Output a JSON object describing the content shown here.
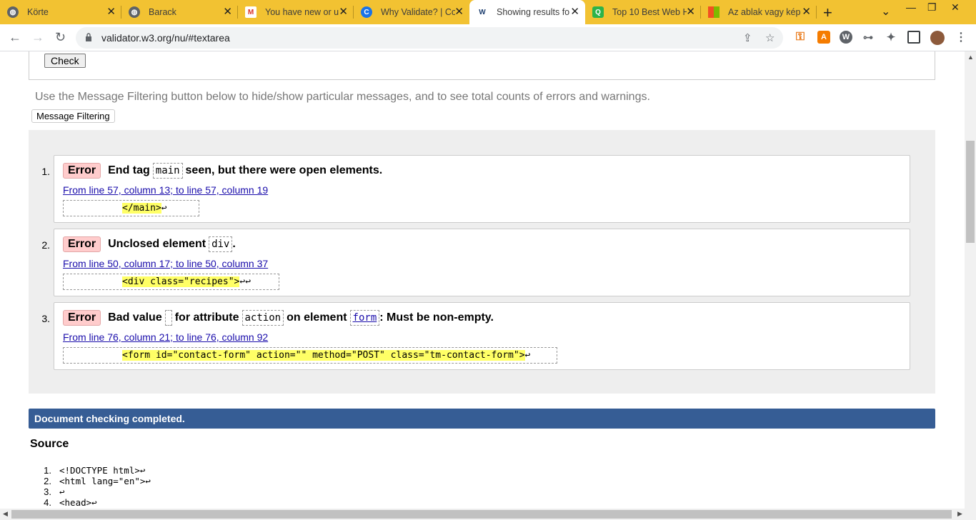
{
  "tabs": [
    {
      "title": "Körte",
      "favicon": "globe-icon",
      "active": false
    },
    {
      "title": "Barack",
      "favicon": "globe-icon",
      "active": false
    },
    {
      "title": "You have new or u",
      "favicon": "gmail-icon",
      "active": false
    },
    {
      "title": "Why Validate? | Co",
      "favicon": "c-icon",
      "active": false
    },
    {
      "title": "Showing results fo",
      "favicon": "w3c-validator-icon",
      "active": true
    },
    {
      "title": "Top 10 Best Web H",
      "favicon": "q-icon",
      "active": false
    },
    {
      "title": "Az ablak vagy kép",
      "favicon": "microsoft-icon",
      "active": false
    }
  ],
  "address_bar": {
    "url": "validator.w3.org/nu/#textarea"
  },
  "form": {
    "check_label": "Check"
  },
  "filter": {
    "note": "Use the Message Filtering button below to hide/show particular messages, and to see total counts of errors and warnings.",
    "button_label": "Message Filtering"
  },
  "messages": [
    {
      "num": "1.",
      "type": "Error",
      "parts": [
        "End tag",
        "main",
        "seen, but there were open elements."
      ],
      "location": "From line 57, column 13; to line 57, column 19",
      "extract_highlight": "</main>",
      "extract_tail": "↩"
    },
    {
      "num": "2.",
      "type": "Error",
      "parts": [
        "Unclosed element",
        "div",
        "."
      ],
      "location": "From line 50, column 17; to line 50, column 37",
      "extract_highlight": "<div class=\"recipes\">",
      "extract_tail": "↩↩"
    },
    {
      "num": "3.",
      "type": "Error",
      "parts": [
        "Bad value",
        "for attribute",
        "action",
        "on element",
        "form",
        ": Must be non-empty."
      ],
      "location": "From line 76, column 21; to line 76, column 92",
      "extract_highlight": "<form id=\"contact-form\" action=\"\" method=\"POST\" class=\"tm-contact-form\">",
      "extract_tail": "↩"
    }
  ],
  "status": "Document checking completed.",
  "source": {
    "heading": "Source",
    "lines": [
      {
        "n": "1.",
        "code": "<!DOCTYPE html>↩"
      },
      {
        "n": "2.",
        "code": "<html lang=\"en\">↩"
      },
      {
        "n": "3.",
        "code": "↩"
      },
      {
        "n": "4.",
        "code": "<head>↩"
      }
    ]
  },
  "colors": {
    "tabstrip": "#f2c232",
    "error_badge": "#ffcccc",
    "status_bar": "#365d95",
    "highlight": "#ffff66"
  }
}
